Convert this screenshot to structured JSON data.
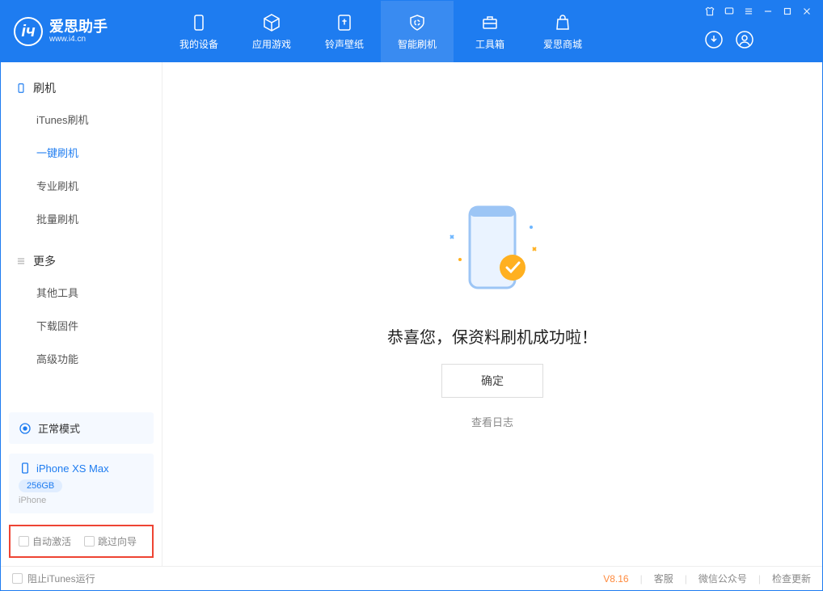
{
  "app": {
    "title": "爱思助手",
    "subtitle": "www.i4.cn"
  },
  "nav": {
    "items": [
      {
        "label": "我的设备"
      },
      {
        "label": "应用游戏"
      },
      {
        "label": "铃声壁纸"
      },
      {
        "label": "智能刷机"
      },
      {
        "label": "工具箱"
      },
      {
        "label": "爱思商城"
      }
    ]
  },
  "sidebar": {
    "section1_title": "刷机",
    "section1_items": [
      "iTunes刷机",
      "一键刷机",
      "专业刷机",
      "批量刷机"
    ],
    "section2_title": "更多",
    "section2_items": [
      "其他工具",
      "下载固件",
      "高级功能"
    ]
  },
  "device": {
    "mode": "正常模式",
    "name": "iPhone XS Max",
    "capacity": "256GB",
    "type": "iPhone"
  },
  "options": {
    "auto_activate": "自动激活",
    "skip_guide": "跳过向导"
  },
  "main": {
    "success_text": "恭喜您，保资料刷机成功啦！",
    "ok_button": "确定",
    "view_log": "查看日志"
  },
  "footer": {
    "block_itunes": "阻止iTunes运行",
    "version": "V8.16",
    "service": "客服",
    "wechat": "微信公众号",
    "check_update": "检查更新"
  }
}
